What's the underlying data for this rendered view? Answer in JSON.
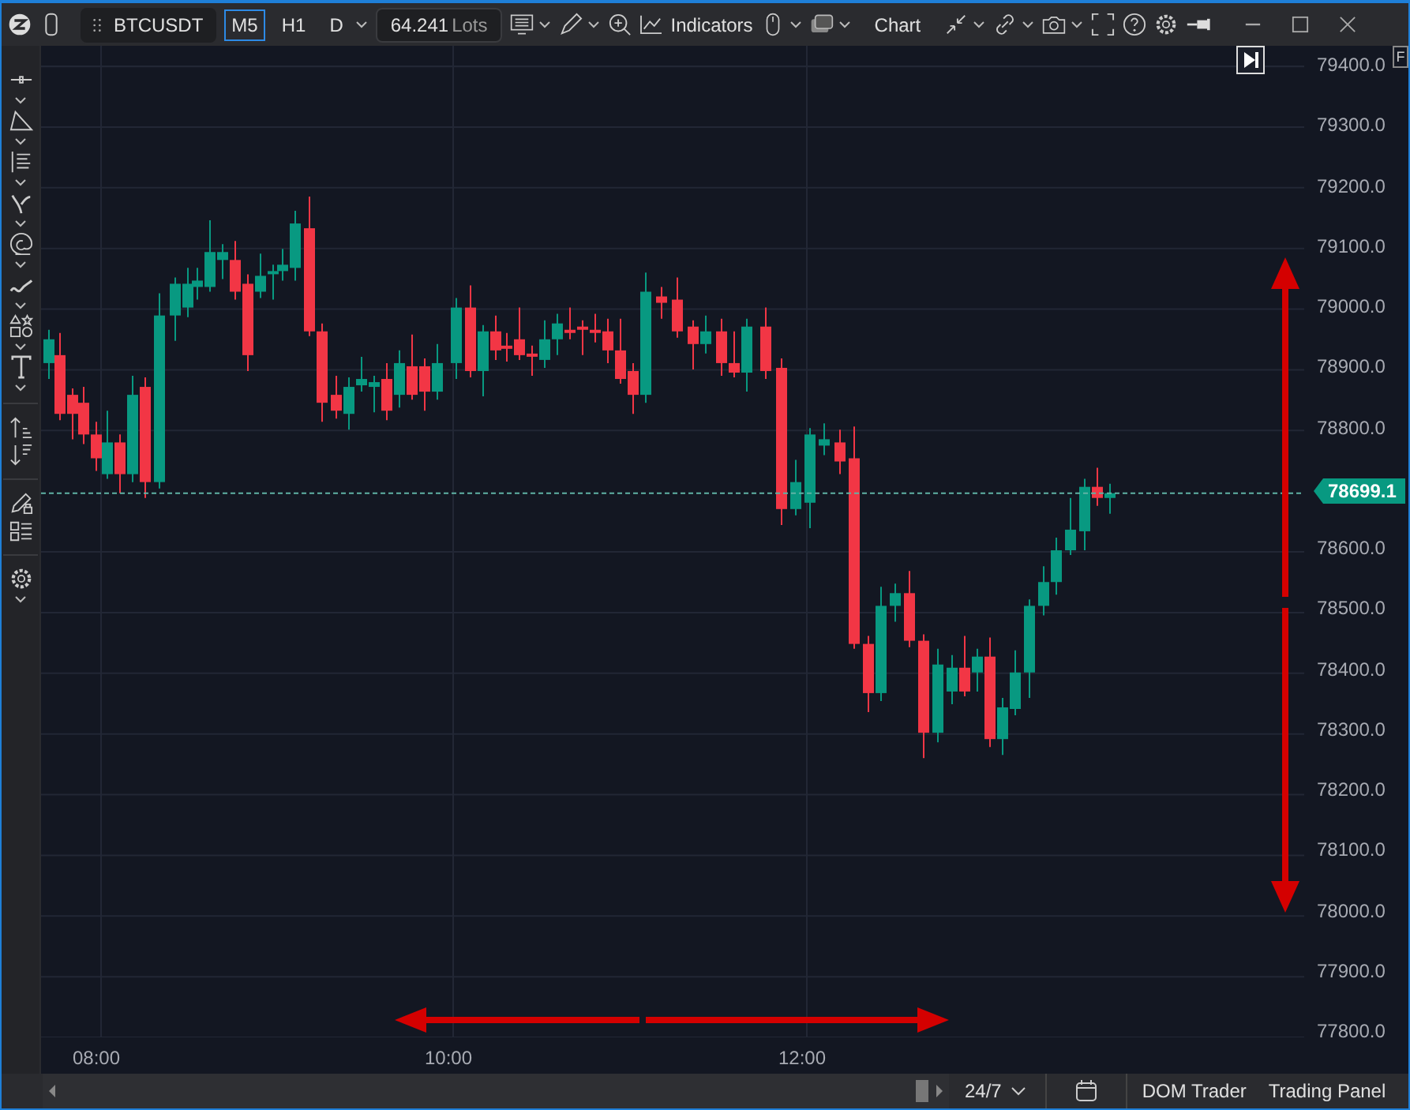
{
  "toolbar": {
    "symbol": "BTCUSDT",
    "timeframes": [
      {
        "label": "M5",
        "selected": true
      },
      {
        "label": "H1",
        "selected": false
      },
      {
        "label": "D",
        "selected": false
      }
    ],
    "lots": {
      "value": "64.241",
      "unit": "Lots"
    },
    "indicators_label": "Indicators",
    "chart_label": "Chart"
  },
  "price_axis": {
    "labels": [
      "79400.0",
      "79300.0",
      "79200.0",
      "79100.0",
      "79000.0",
      "78900.0",
      "78800.0",
      "78600.0",
      "78500.0",
      "78400.0",
      "78300.0",
      "78200.0",
      "78100.0",
      "78000.0",
      "77900.0",
      "77800.0"
    ],
    "current_price": "78699.1",
    "corner_button": "F"
  },
  "time_axis": {
    "labels": [
      "08:00",
      "10:00",
      "12:00"
    ]
  },
  "bottom_bar": {
    "session": "24/7",
    "buttons": [
      "DOM Trader",
      "Trading Panel"
    ]
  }
}
